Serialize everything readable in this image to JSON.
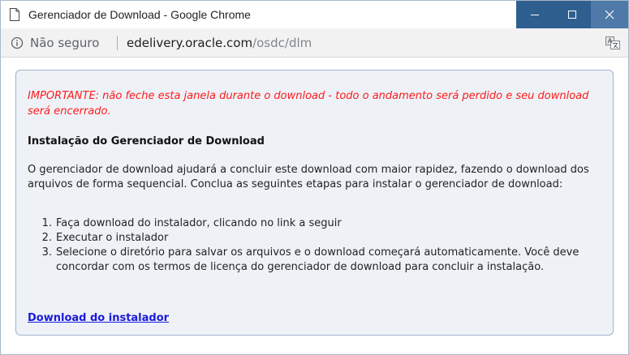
{
  "window": {
    "title": "Gerenciador de Download - Google Chrome"
  },
  "addressbar": {
    "security_label": "Não seguro",
    "url_host": "edelivery.oracle.com",
    "url_path": "/osdc/dlm"
  },
  "content": {
    "warning": "IMPORTANTE: não feche esta janela durante o download - todo o andamento será perdido e seu download será encerrado.",
    "title": "Instalação do Gerenciador de Download",
    "intro": "O gerenciador de download ajudará a concluir este download com maior rapidez, fazendo o download dos arquivos de forma sequencial. Conclua as seguintes etapas para instalar o gerenciador de download:",
    "steps": [
      {
        "num": "1.",
        "text": "Faça download do instalador, clicando no link a seguir"
      },
      {
        "num": "2.",
        "text": "Executar o instalador"
      },
      {
        "num": "3.",
        "text": "Selecione o diretório para salvar os arquivos e o download começará automaticamente. Você deve concordar com os termos de licença do gerenciador de download para concluir a instalação."
      }
    ],
    "download_link": "Download do instalador"
  },
  "colors": {
    "warning": "#ff1a1a",
    "link": "#1a1adb",
    "panel_bg": "#eef2f7",
    "panel_border": "#9fb4cc",
    "titlebar_buttons": "#2f5f8f"
  },
  "icons": [
    "page-icon",
    "minimize-icon",
    "maximize-icon",
    "close-icon",
    "info-icon",
    "translate-icon"
  ]
}
